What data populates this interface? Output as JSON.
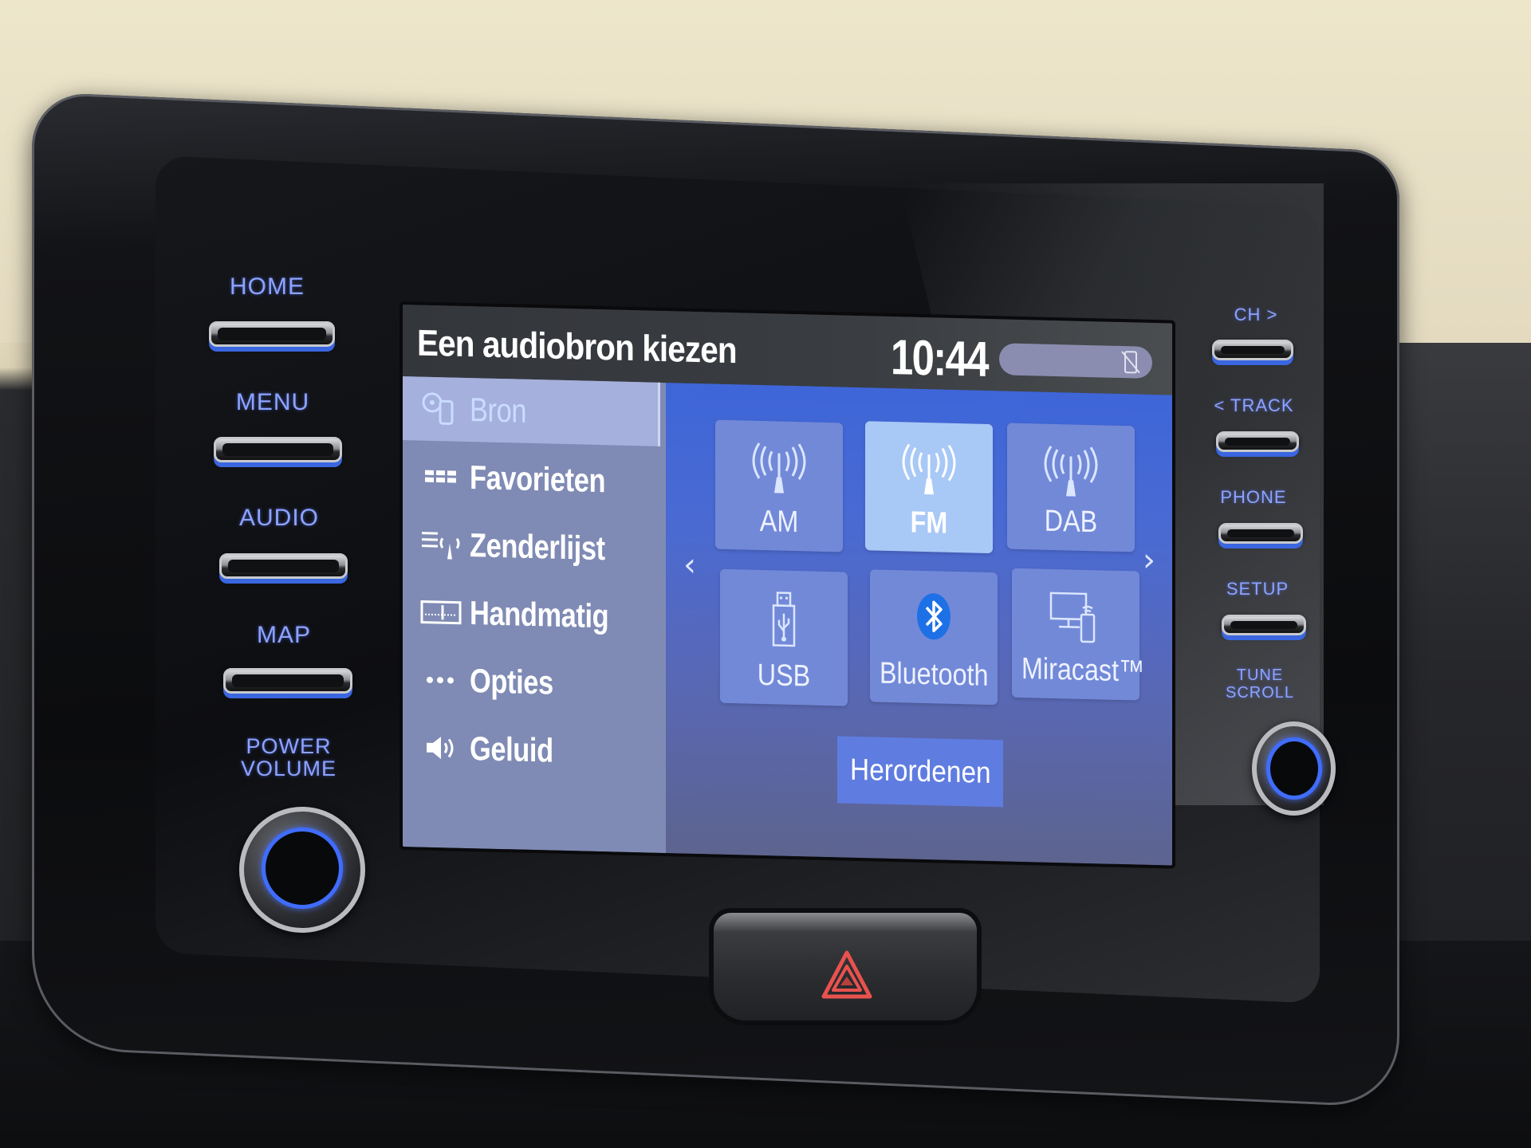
{
  "screen": {
    "title": "Een audiobron kiezen",
    "clock": "10:44",
    "status_icon": "phone-disconnected-icon"
  },
  "sidebar": {
    "items": [
      {
        "label": "Bron",
        "icon": "source-icon",
        "active": true
      },
      {
        "label": "Favorieten",
        "icon": "favorites-icon",
        "active": false
      },
      {
        "label": "Zenderlijst",
        "icon": "station-list-icon",
        "active": false
      },
      {
        "label": "Handmatig",
        "icon": "manual-tune-icon",
        "active": false
      },
      {
        "label": "Opties",
        "icon": "options-icon",
        "active": false
      },
      {
        "label": "Geluid",
        "icon": "speaker-icon",
        "active": false
      }
    ]
  },
  "sources": {
    "tiles": [
      {
        "label": "AM",
        "icon": "antenna-icon",
        "active": false
      },
      {
        "label": "FM",
        "icon": "antenna-icon",
        "active": true
      },
      {
        "label": "DAB",
        "icon": "antenna-icon",
        "active": false
      },
      {
        "label": "USB",
        "icon": "usb-icon",
        "active": false
      },
      {
        "label": "Bluetooth",
        "icon": "bluetooth-icon",
        "active": false
      },
      {
        "label": "Miracast™",
        "icon": "miracast-icon",
        "active": false
      }
    ],
    "prev_arrow": "‹",
    "next_arrow": "›",
    "reorder_label": "Herordenen"
  },
  "hardware": {
    "left_buttons": [
      "HOME",
      "MENU",
      "AUDIO",
      "MAP"
    ],
    "power_volume": [
      "POWER",
      "VOLUME"
    ],
    "right_buttons": [
      "CH >",
      "< TRACK",
      "PHONE",
      "SETUP"
    ],
    "tune_scroll": [
      "TUNE",
      "SCROLL"
    ]
  },
  "colors": {
    "hw_label": "#8da3ff",
    "accent_ring": "#3f6dff",
    "sidebar_bg": "#7f8bb4",
    "content_bg": "#3e66d8",
    "tile": "#7289d8",
    "tile_active": "#a8c8f6",
    "hazard": "#e8524e"
  }
}
